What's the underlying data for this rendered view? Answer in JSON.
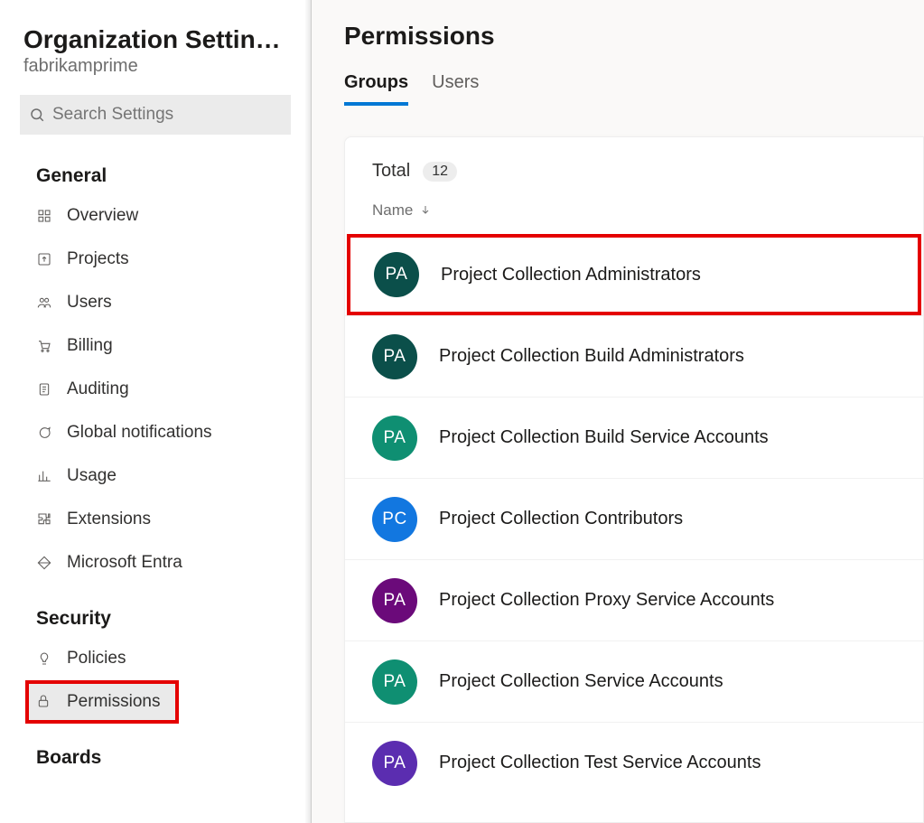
{
  "sidebar": {
    "title": "Organization Settin…",
    "subtitle": "fabrikamprime",
    "search_placeholder": "Search Settings",
    "sections": {
      "general": {
        "label": "General",
        "items": [
          {
            "icon": "grid-icon",
            "label": "Overview"
          },
          {
            "icon": "upload-icon",
            "label": "Projects"
          },
          {
            "icon": "users-icon",
            "label": "Users"
          },
          {
            "icon": "cart-icon",
            "label": "Billing"
          },
          {
            "icon": "clipboard-icon",
            "label": "Auditing"
          },
          {
            "icon": "chat-icon",
            "label": "Global notifications"
          },
          {
            "icon": "chart-icon",
            "label": "Usage"
          },
          {
            "icon": "puzzle-icon",
            "label": "Extensions"
          },
          {
            "icon": "diamond-icon",
            "label": "Microsoft Entra"
          }
        ]
      },
      "security": {
        "label": "Security",
        "items": [
          {
            "icon": "bulb-icon",
            "label": "Policies"
          },
          {
            "icon": "lock-icon",
            "label": "Permissions",
            "selected": true,
            "highlight": true
          }
        ]
      },
      "boards": {
        "label": "Boards"
      }
    }
  },
  "main": {
    "title": "Permissions",
    "tabs": [
      {
        "label": "Groups",
        "active": true
      },
      {
        "label": "Users",
        "active": false
      }
    ],
    "total_label": "Total",
    "total_count": "12",
    "column_header": "Name",
    "groups": [
      {
        "initials": "PA",
        "color": "#0b4f4a",
        "name": "Project Collection Administrators",
        "highlight": true
      },
      {
        "initials": "PA",
        "color": "#0b4f4a",
        "name": "Project Collection Build Administrators"
      },
      {
        "initials": "PA",
        "color": "#0f8f72",
        "name": "Project Collection Build Service Accounts"
      },
      {
        "initials": "PC",
        "color": "#1277e0",
        "name": "Project Collection Contributors"
      },
      {
        "initials": "PA",
        "color": "#6b0a7a",
        "name": "Project Collection Proxy Service Accounts"
      },
      {
        "initials": "PA",
        "color": "#0f8f72",
        "name": "Project Collection Service Accounts"
      },
      {
        "initials": "PA",
        "color": "#5b2db0",
        "name": "Project Collection Test Service Accounts"
      }
    ]
  }
}
